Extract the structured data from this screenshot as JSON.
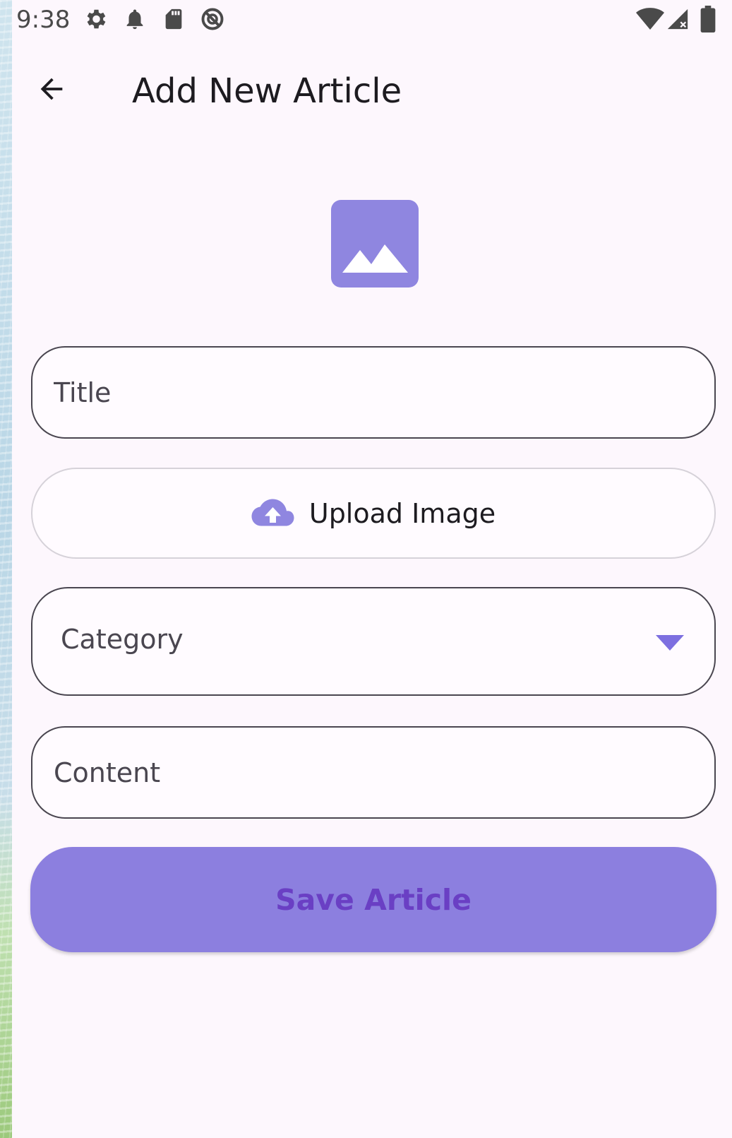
{
  "status_bar": {
    "time": "9:38",
    "icons": [
      "gear-icon",
      "bell-icon",
      "sd-card-icon",
      "sync-disabled-icon",
      "wifi-icon",
      "signal-icon",
      "battery-icon"
    ]
  },
  "app_bar": {
    "back_icon": "arrow-left-icon",
    "title": "Add New Article"
  },
  "image_preview": {
    "icon": "image-icon",
    "color": "#8f86e0"
  },
  "form": {
    "title_placeholder": "Title",
    "upload_label": "Upload Image",
    "upload_icon": "cloud-upload-icon",
    "category_label": "Category",
    "category_icon": "dropdown-arrow-icon",
    "content_placeholder": "Content",
    "save_label": "Save Article"
  },
  "colors": {
    "accent": "#8c7fdf",
    "accent_text": "#6a3fc4",
    "surface": "#fdf7fd",
    "outline": "#4a4650"
  }
}
